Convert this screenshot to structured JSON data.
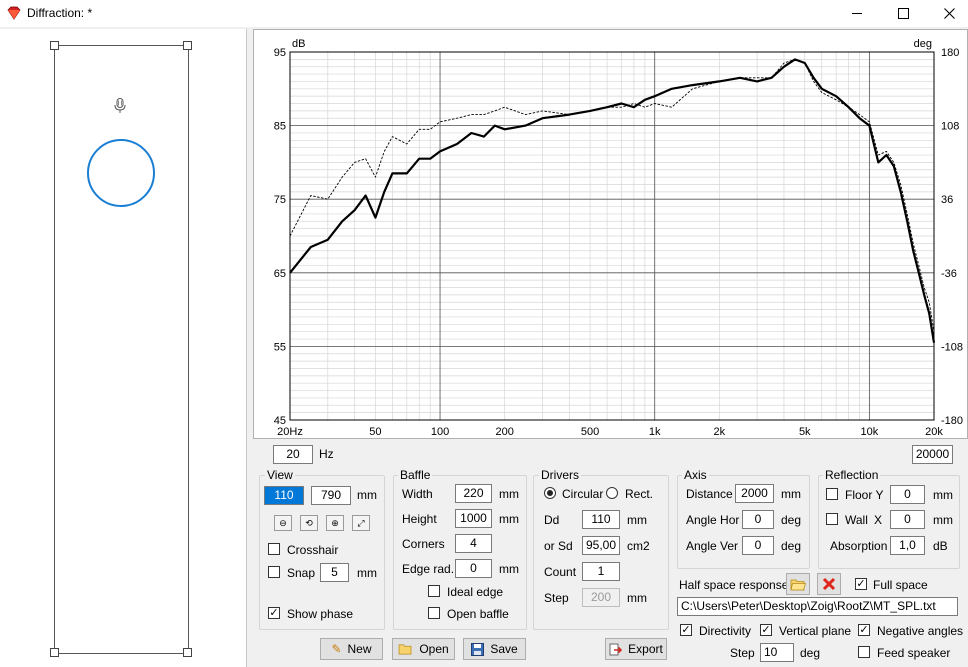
{
  "window": {
    "title": "Diffraction: *",
    "minimize_icon": "minimize-icon",
    "maximize_icon": "maximize-icon",
    "close_icon": "close-icon"
  },
  "chart_data": {
    "type": "line",
    "y_left_label": "dB",
    "y_right_label": "deg",
    "x_scale": "log",
    "x_range": [
      20,
      20000
    ],
    "y_left_range": [
      45,
      95
    ],
    "y_right_range": [
      -180,
      180
    ],
    "x_ticks": [
      "20Hz",
      "50",
      "100",
      "200",
      "500",
      "1k",
      "2k",
      "5k",
      "10k",
      "20k"
    ],
    "y_left_ticks": [
      "95",
      "85",
      "75",
      "65",
      "55",
      "45"
    ],
    "y_right_ticks": [
      "180",
      "108",
      "36",
      "-36",
      "-108",
      "-180"
    ],
    "grid": true,
    "series": [
      {
        "style": "solid-thick",
        "color": "#000000",
        "x": [
          20,
          25,
          30,
          35,
          40,
          45,
          50,
          55,
          60,
          70,
          80,
          90,
          100,
          120,
          140,
          160,
          180,
          200,
          250,
          300,
          400,
          500,
          600,
          700,
          800,
          900,
          1000,
          1200,
          1500,
          2000,
          2500,
          3000,
          3500,
          4000,
          4500,
          5000,
          5500,
          6000,
          7000,
          8000,
          9000,
          10000,
          11000,
          12000,
          13000,
          14000,
          15000,
          16000,
          17000,
          18000,
          19000,
          20000
        ],
        "y": [
          65,
          68.5,
          69.5,
          72,
          73.5,
          75.5,
          72.5,
          76,
          78.5,
          78.5,
          80.5,
          80.5,
          81.5,
          82.5,
          84,
          83.5,
          85,
          84.5,
          85,
          86,
          86.5,
          87,
          87.5,
          88,
          87.5,
          88.5,
          89,
          90,
          90.5,
          91,
          91.5,
          91,
          91.5,
          93,
          94,
          93.5,
          91.5,
          90,
          89,
          87.5,
          86,
          85,
          80,
          81,
          79.5,
          76,
          72,
          68,
          65,
          62,
          59.5,
          55.5
        ]
      },
      {
        "style": "dashed-thin",
        "color": "#000000",
        "x": [
          20,
          25,
          30,
          35,
          40,
          45,
          50,
          55,
          60,
          70,
          80,
          90,
          100,
          120,
          140,
          160,
          180,
          200,
          250,
          300,
          400,
          500,
          600,
          700,
          800,
          900,
          1000,
          1200,
          1500,
          2000,
          2500,
          3000,
          3500,
          4000,
          4500,
          5000,
          5500,
          6000,
          7000,
          8000,
          9000,
          10000,
          11000,
          12000,
          13000,
          14000,
          15000,
          16000,
          17000,
          18000,
          19000,
          20000
        ],
        "y": [
          70,
          75.5,
          75,
          78,
          80,
          80.5,
          78,
          81.5,
          83.5,
          82.5,
          84.5,
          84.5,
          85.5,
          86,
          86.5,
          86.5,
          87,
          87.5,
          86.5,
          87,
          86.5,
          87,
          87.5,
          87.5,
          88,
          87.5,
          88,
          87.5,
          90,
          91,
          91.5,
          91.5,
          91.5,
          93.5,
          94,
          93.5,
          91,
          89.5,
          88.5,
          87.5,
          86.5,
          85.5,
          81,
          81.5,
          80,
          77,
          73,
          69,
          66,
          63,
          61,
          57
        ]
      }
    ]
  },
  "freq_range": {
    "min_value": "20",
    "unit": "Hz",
    "max_value": "20000"
  },
  "view": {
    "title": "View",
    "width_value": "110",
    "height_value": "790",
    "unit": "mm",
    "tools": [
      "zoom-out-icon",
      "zoom-reset-icon",
      "zoom-in-icon",
      "fit-icon"
    ],
    "crosshair_label": "Crosshair",
    "snap_label": "Snap",
    "snap_value": "5",
    "snap_unit": "mm",
    "show_phase_label": "Show phase"
  },
  "baffle": {
    "title": "Baffle",
    "width_label": "Width",
    "width_value": "220",
    "width_unit": "mm",
    "height_label": "Height",
    "height_value": "1000",
    "height_unit": "mm",
    "corners_label": "Corners",
    "corners_value": "4",
    "edge_rad_label": "Edge rad.",
    "edge_rad_value": "0",
    "edge_rad_unit": "mm",
    "ideal_edge_label": "Ideal edge",
    "open_baffle_label": "Open baffle"
  },
  "drivers": {
    "title": "Drivers",
    "circular_label": "Circular",
    "rect_label": "Rect.",
    "dd_label": "Dd",
    "dd_value": "110",
    "dd_unit": "mm",
    "sd_label": "or Sd",
    "sd_value": "95,00",
    "sd_unit": "cm2",
    "count_label": "Count",
    "count_value": "1",
    "step_label": "Step",
    "step_value": "200",
    "step_unit": "mm"
  },
  "axis": {
    "title": "Axis",
    "distance_label": "Distance",
    "distance_value": "2000",
    "distance_unit": "mm",
    "angle_hor_label": "Angle Hor",
    "angle_hor_value": "0",
    "angle_hor_unit": "deg",
    "angle_ver_label": "Angle Ver",
    "angle_ver_value": "0",
    "angle_ver_unit": "deg"
  },
  "reflection": {
    "title": "Reflection",
    "floor_label": "Floor Y",
    "floor_value": "0",
    "floor_unit": "mm",
    "wall_label": "Wall",
    "wall_axis": "X",
    "wall_value": "0",
    "wall_unit": "mm",
    "absorption_label": "Absorption",
    "absorption_value": "1,0",
    "absorption_unit": "dB"
  },
  "half_space": {
    "label": "Half space response",
    "full_space_label": "Full space",
    "path": "C:\\Users\\Peter\\Desktop\\Zoig\\RootZ\\MT_SPL.txt"
  },
  "options": {
    "directivity_label": "Directivity",
    "vertical_plane_label": "Vertical plane",
    "negative_angles_label": "Negative angles",
    "step_label": "Step",
    "step_value": "10",
    "step_unit": "deg",
    "feed_speaker_label": "Feed speaker"
  },
  "buttons": {
    "new_label": "New",
    "open_label": "Open",
    "save_label": "Save",
    "export_label": "Export"
  }
}
